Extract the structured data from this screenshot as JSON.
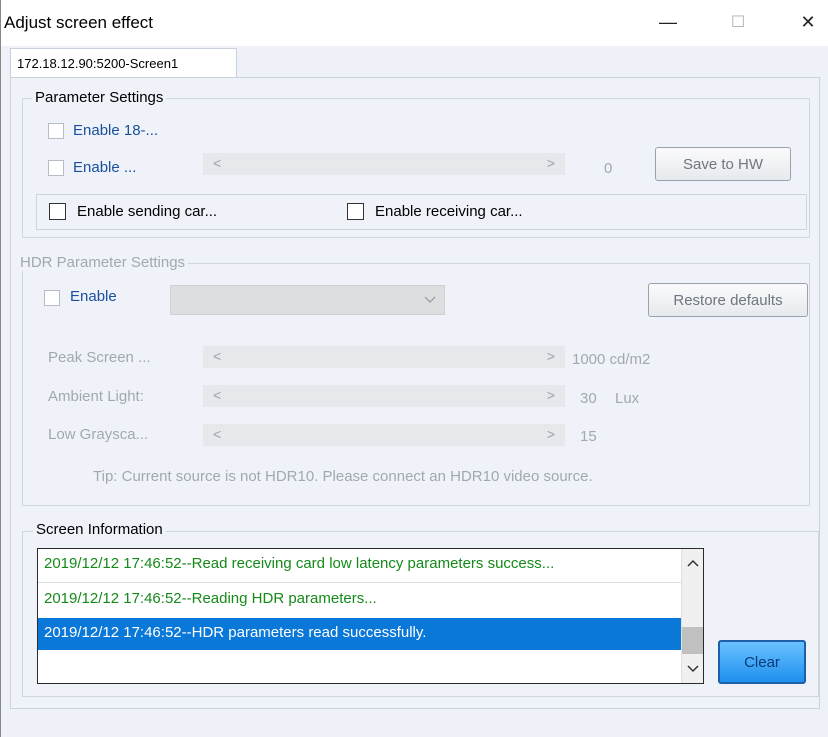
{
  "window": {
    "title": "Adjust screen effect",
    "minimize_glyph": "—",
    "maximize_glyph": "☐",
    "close_glyph": "✕"
  },
  "tab": {
    "label": "172.18.12.90:5200-Screen1"
  },
  "parameter_settings": {
    "title": "Parameter Settings",
    "enable_18_label": "Enable 18-...",
    "enable_label": "Enable ...",
    "slider_value": "0",
    "save_button": "Save to HW",
    "enable_sending_label": "Enable sending car...",
    "enable_receiving_label": "Enable receiving car..."
  },
  "hdr": {
    "title": "HDR Parameter Settings",
    "enable_label": "Enable",
    "combo_value": "",
    "restore_button": "Restore defaults",
    "peak_label": "Peak Screen ...",
    "peak_value": "1000 cd/m2",
    "ambient_label": "Ambient Light:",
    "ambient_value": "30",
    "ambient_unit": "Lux",
    "lowgray_label": "Low Graysca...",
    "lowgray_value": "15",
    "tip": "Tip: Current source is not HDR10. Please connect an HDR10 video source."
  },
  "screen_info": {
    "title": "Screen Information",
    "rows": [
      "2019/12/12 17:46:52--Read receiving card low latency parameters success...",
      "2019/12/12 17:46:52--Reading HDR parameters...",
      "2019/12/12 17:46:52--HDR parameters read successfully."
    ],
    "clear_button": "Clear"
  },
  "colors": {
    "accent": "#0a78d8",
    "success_text": "#158a1a",
    "link_blue": "#1a4fa0"
  }
}
